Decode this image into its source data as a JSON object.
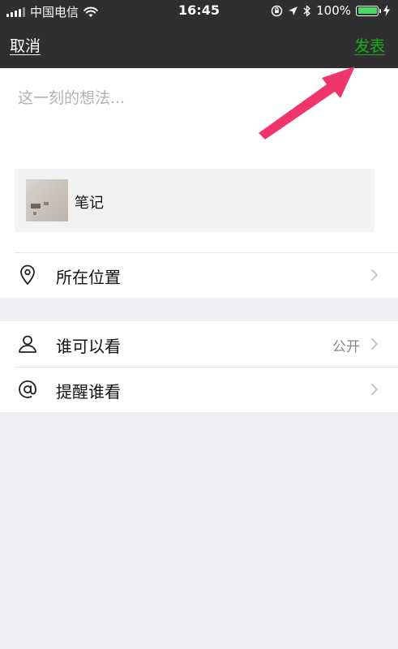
{
  "status_bar": {
    "carrier": "中国电信",
    "time": "16:45",
    "battery": "100%",
    "battery_level": 1.0,
    "icons": [
      "signal-icon",
      "wifi-icon",
      "orientation-lock-icon",
      "location-icon",
      "bluetooth-icon",
      "battery-icon",
      "charging-icon"
    ]
  },
  "nav": {
    "cancel_label": "取消",
    "publish_label": "发表",
    "publish_color": "#1aad19"
  },
  "compose": {
    "placeholder": "这一刻的想法...",
    "value": ""
  },
  "attachment": {
    "label": "笔记"
  },
  "rows": {
    "location": {
      "label": "所在位置",
      "icon": "location-pin-icon"
    },
    "visibility": {
      "label": "谁可以看",
      "value": "公开",
      "icon": "person-icon"
    },
    "mention": {
      "label": "提醒谁看",
      "icon": "at-icon"
    }
  },
  "colors": {
    "topbar": "#2f2f31",
    "background": "#efeff4",
    "annotation_arrow": "#f0356b"
  }
}
